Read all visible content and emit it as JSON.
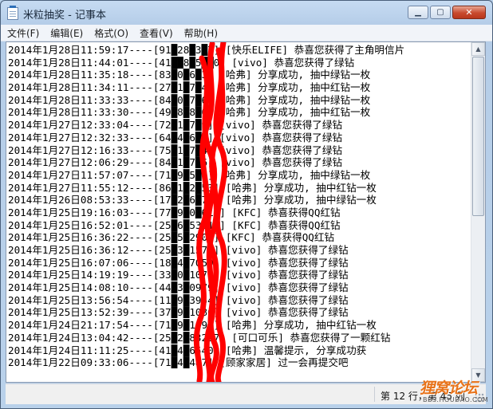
{
  "window": {
    "title": "米粒抽奖 - 记事本",
    "controls": {
      "minimize": "▁",
      "maximize": "▢",
      "close": "✕"
    }
  },
  "menu": [
    "文件(F)",
    "编辑(E)",
    "格式(O)",
    "查看(V)",
    "帮助(H)"
  ],
  "lines": [
    "2014年1月28日11:59:17----[91█28█3█7] [快乐ELIFE] 恭喜您获得了主角明信片",
    "2014年1月28日11:44:01----[41██8█5██0] [vivo] 恭喜您获得了绿钻",
    "2014年1月28日11:35:18----[83█0█6█3] [哈弗] 分享成功, 抽中绿钻一枚",
    "2014年1月28日11:34:11----[27█1█7█4] [哈弗] 分享成功, 抽中红钻一枚",
    "2014年1月28日11:33:33----[84█0█7█6] [哈弗] 分享成功, 抽中绿钻一枚",
    "2014年1月28日11:33:30----[49█8█8█6] [哈弗] 分享成功, 抽中红钻一枚",
    "2014年1月27日12:33:04----[72█1█7█9] [vivo] 恭喜您获得了绿钻",
    "2014年1月27日12:32:33----[64█4█6█7] [vivo] 恭喜您获得了绿钻",
    "2014年1月27日12:16:33----[75█1█7█4] [vivo] 恭喜您获得了绿钻",
    "2014年1月27日12:06:29----[84█1█7█6] [vivo] 恭喜您获得了绿钻",
    "2014年1月27日11:57:07----[71█9█5█7] [哈弗] 分享成功, 抽中绿钻一枚",
    "2014年1月27日11:55:12----[86█1█2█53] [哈弗] 分享成功, 抽中红钻一枚",
    "2014年1月26日08:53:33----[17█2█6█73] [哈弗] 分享成功, 抽中绿钻一枚",
    "2014年1月25日19:16:03----[77█9█0█614] [KFC] 恭喜获得QQ红钻",
    "2014年1月25日16:52:01----[25█6█53318] [KFC] 恭喜获得QQ红钻",
    "2014年1月25日16:36:22----[25█5█2907] [KFC] 恭喜获得QQ红钻",
    "2014年1月25日16:36:12----[25█3█1576] [vivo] 恭喜您获得了绿钻",
    "2014年1月25日16:07:06----[18█4█7059] [vivo] 恭喜您获得了绿钻",
    "2014年1月25日14:19:19----[33█0█1074] [vivo] 恭喜您获得了绿钻",
    "2014年1月25日14:08:10----[44█3█0979] [vivo] 恭喜您获得了绿钻",
    "2014年1月25日13:56:54----[11█9█3954] [vivo] 恭喜您获得了绿钻",
    "2014年1月25日13:52:39----[37█9█1086] [vivo] 恭喜您获得了绿钻",
    "2014年1月24日21:17:54----[71█9█1994] [哈弗] 分享成功, 抽中红钻一枚",
    "2014年1月24日13:04:42----[25█2█83227] [可口可乐] 恭喜您获得了一颗红钻",
    "2014年1月24日11:11:25----[41█4█6540] [哈弗] 温馨提示, 分享成功获",
    "2014年1月22日09:33:06----[71█4█487] [顾家家居] 过一会再提交吧"
  ],
  "status": {
    "position": "第 12 行，第 45 列"
  },
  "watermark": {
    "main": "狸窝论坛",
    "sub": "BBS.HOUDAO.COM"
  },
  "colors": {
    "scribble": "#ff0000",
    "watermark": "#e8731a"
  }
}
